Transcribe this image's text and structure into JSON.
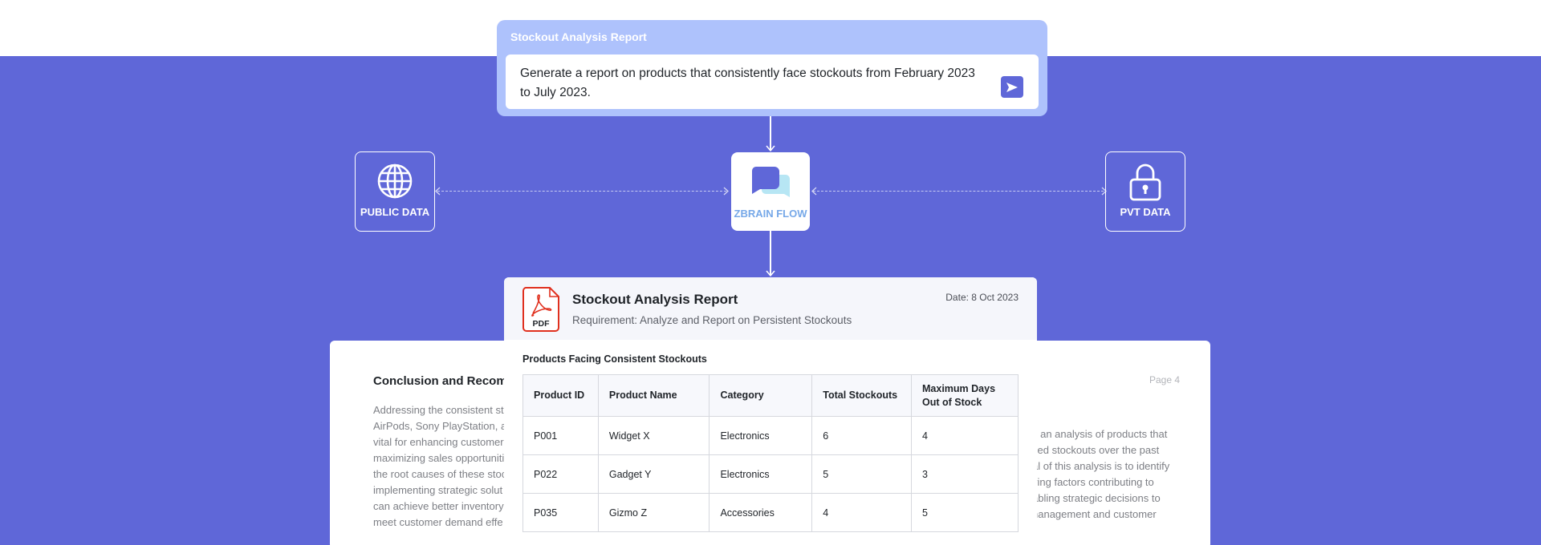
{
  "prompt": {
    "title": "Stockout Analysis Report",
    "text": "Generate a report on products that consistently face stockouts from February 2023 to July 2023."
  },
  "flow": {
    "left_label": "PUBLIC DATA",
    "center_label": "ZBRAIN FLOW",
    "right_label": "PVT DATA"
  },
  "report": {
    "file_type": "PDF",
    "title": "Stockout Analysis Report",
    "requirement": "Requirement: Analyze and Report on Persistent Stockouts",
    "date": "Date: 8 Oct 2023",
    "table_title": "Products Facing Consistent Stockouts",
    "columns": [
      "Product ID",
      "Product Name",
      "Category",
      "Total Stockouts",
      "Maximum Days Out of Stock"
    ],
    "rows": [
      [
        "P001",
        "Widget X",
        "Electronics",
        "6",
        "4"
      ],
      [
        "P022",
        "Gadget Y",
        "Electronics",
        "5",
        "3"
      ],
      [
        "P035",
        "Gizmo Z",
        "Accessories",
        "4",
        "5"
      ]
    ]
  },
  "back_page": {
    "title": "Conclusion and Recomme",
    "left_lines": [
      "Addressing the consistent st",
      "AirPods, Sony PlayStation, ar",
      "vital for enhancing customer",
      "maximizing sales opportuniti",
      "the root causes of these stoc",
      "implementing strategic solut",
      "can achieve better inventory",
      "meet customer demand effe"
    ],
    "right_lines": [
      "s an analysis of products that",
      "ced stockouts over the past",
      "al of this analysis is to identify",
      "ying factors contributing to",
      "abling strategic decisions to",
      "nanagement and customer"
    ],
    "page_number": "Page 4"
  },
  "colors": {
    "band": "#5f67d8",
    "prompt_card": "#aec2fc",
    "pdf_red": "#e0301e",
    "zbrain_blue": "#76a8e8"
  },
  "icons": {
    "send": "send-icon",
    "public": "globe-icon",
    "private": "lock-icon",
    "center": "chat-bubbles-icon",
    "file": "pdf-icon"
  }
}
